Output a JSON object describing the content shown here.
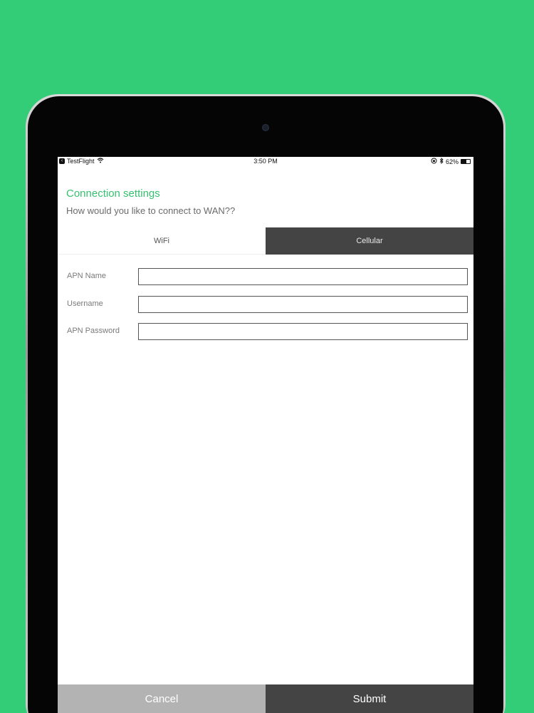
{
  "status_bar": {
    "app_back": "TestFlight",
    "time": "3:50 PM",
    "battery_percent": "62%",
    "battery_level": 0.62,
    "icons": [
      "back-arrow-icon",
      "wifi-icon",
      "orientation-lock-icon",
      "bluetooth-icon",
      "battery-icon"
    ]
  },
  "header": {
    "title": "Connection settings",
    "subtitle": "How would you like to connect to WAN??"
  },
  "tabs": [
    {
      "label": "WiFi",
      "selected": false
    },
    {
      "label": "Cellular",
      "selected": true
    }
  ],
  "form": {
    "fields": [
      {
        "label": "APN Name",
        "value": "",
        "placeholder": ""
      },
      {
        "label": "Username",
        "value": "",
        "placeholder": ""
      },
      {
        "label": "APN Password",
        "value": "",
        "placeholder": ""
      }
    ]
  },
  "actions": {
    "cancel_label": "Cancel",
    "submit_label": "Submit"
  },
  "colors": {
    "background": "#33cc77",
    "accent": "#37c06f",
    "tab_selected": "#444444",
    "cancel_button": "#b3b3b3",
    "submit_button": "#444444"
  }
}
